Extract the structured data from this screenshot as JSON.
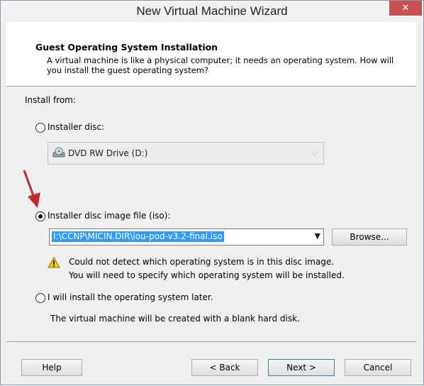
{
  "window": {
    "title": "New Virtual Machine Wizard",
    "close_glyph": "✕"
  },
  "header": {
    "title": "Guest Operating System Installation",
    "description": "A virtual machine is like a physical computer; it needs an operating system. How will you install the guest operating system?"
  },
  "install_from": {
    "label": "Install from:",
    "installer_disc": {
      "label": "Installer disc:",
      "selected": false,
      "drive_value": "DVD RW Drive (D:)"
    },
    "disc_image": {
      "label": "Installer disc image file (iso):",
      "selected": true,
      "path_value": "I:\\CCNP\\MICIN.DIR\\iou-pod-v3.2-final.iso",
      "browse_label": "Browse...",
      "warning_line1": "Could not detect which operating system is in this disc image.",
      "warning_line2": "You will need to specify which operating system will be installed."
    },
    "install_later": {
      "label": "I will install the operating system later.",
      "selected": false,
      "note": "The virtual machine will be created with a blank hard disk."
    }
  },
  "footer": {
    "help_label": "Help",
    "back_label": "< Back",
    "next_label": "Next >",
    "cancel_label": "Cancel"
  },
  "colors": {
    "selection": "#3399ff",
    "close_button": "#c75050",
    "annotation_arrow": "#c0282c",
    "warning": "#f5d000"
  },
  "icons": [
    "close-icon",
    "dvd-drive-icon",
    "chevron-down-icon",
    "warning-icon",
    "red-arrow-annotation"
  ]
}
